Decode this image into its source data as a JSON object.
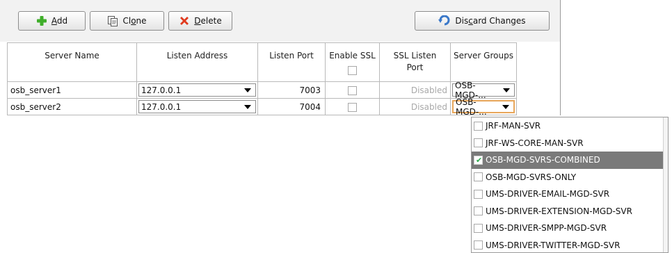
{
  "toolbar": {
    "add": {
      "pre": "",
      "u": "A",
      "post": "dd"
    },
    "clone": {
      "pre": "Cl",
      "u": "o",
      "post": "ne"
    },
    "delete": {
      "pre": "",
      "u": "D",
      "post": "elete"
    },
    "discard": {
      "pre": "Dis",
      "u": "c",
      "post": "ard Changes"
    }
  },
  "table": {
    "columns": {
      "server_name": "Server Name",
      "listen_address": "Listen Address",
      "listen_port": "Listen Port",
      "enable_ssl": "Enable SSL",
      "ssl_listen_port_line1": "SSL Listen",
      "ssl_listen_port_line2": "Port",
      "server_groups": "Server Groups"
    },
    "rows": [
      {
        "name": "osb_server1",
        "address": "127.0.0.1",
        "port": "7003",
        "ssl_port": "Disabled",
        "groups": "OSB-MGD-..."
      },
      {
        "name": "osb_server2",
        "address": "127.0.0.1",
        "port": "7004",
        "ssl_port": "Disabled",
        "groups": "OSB-MGD-..."
      }
    ]
  },
  "dropdown": {
    "items": [
      {
        "label": "JRF-MAN-SVR",
        "checked": false
      },
      {
        "label": "JRF-WS-CORE-MAN-SVR",
        "checked": false
      },
      {
        "label": "OSB-MGD-SVRS-COMBINED",
        "checked": true
      },
      {
        "label": "OSB-MGD-SVRS-ONLY",
        "checked": false
      },
      {
        "label": "UMS-DRIVER-EMAIL-MGD-SVR",
        "checked": false
      },
      {
        "label": "UMS-DRIVER-EXTENSION-MGD-SVR",
        "checked": false
      },
      {
        "label": "UMS-DRIVER-SMPP-MGD-SVR",
        "checked": false
      },
      {
        "label": "UMS-DRIVER-TWITTER-MGD-SVR",
        "checked": false
      }
    ]
  },
  "colors": {
    "add_icon": "#3fae2a",
    "delete_icon": "#e03a1e",
    "focus_border": "#e8a65a",
    "selected_row": "#7a7a7a"
  }
}
